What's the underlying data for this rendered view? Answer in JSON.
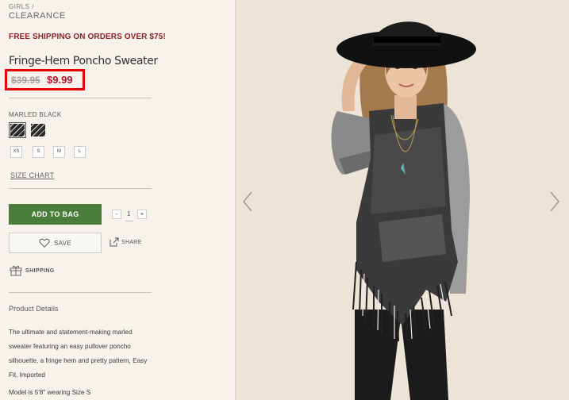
{
  "breadcrumb": {
    "level1": "GIRLS  /",
    "level2": "CLEARANCE"
  },
  "promo": "FREE SHIPPING ON ORDERS OVER $75!",
  "product": {
    "title": "Fringe-Hem Poncho Sweater",
    "price_original": "$39.95",
    "price_sale": "$9.99",
    "color_label": "MARLED BLACK",
    "sizes": [
      "XS",
      "S",
      "M",
      "L"
    ],
    "size_chart_label": "SIZE CHART",
    "quantity": "1",
    "qty_minus": "-",
    "qty_plus": "+"
  },
  "actions": {
    "add_to_bag": "ADD TO BAG",
    "save": "SAVE",
    "share": "SHARE",
    "shipping": "SHIPPING"
  },
  "details": {
    "heading": "Product Details",
    "description": "The ultimate and statement-making marled sweater featuring an easy pullover poncho silhouette, a fringe hem and pretty pattern, Easy Fit, Imported",
    "model_info": "Model is 5'8\" wearing Size S"
  },
  "colors": {
    "accent_red": "#e8000b",
    "sale_red": "#b8102a",
    "promo_red": "#8c2224",
    "button_green": "#4b7d3a"
  },
  "icons": [
    "heart-icon",
    "share-icon",
    "gift-box-icon",
    "chevron-left-icon",
    "chevron-right-icon"
  ]
}
